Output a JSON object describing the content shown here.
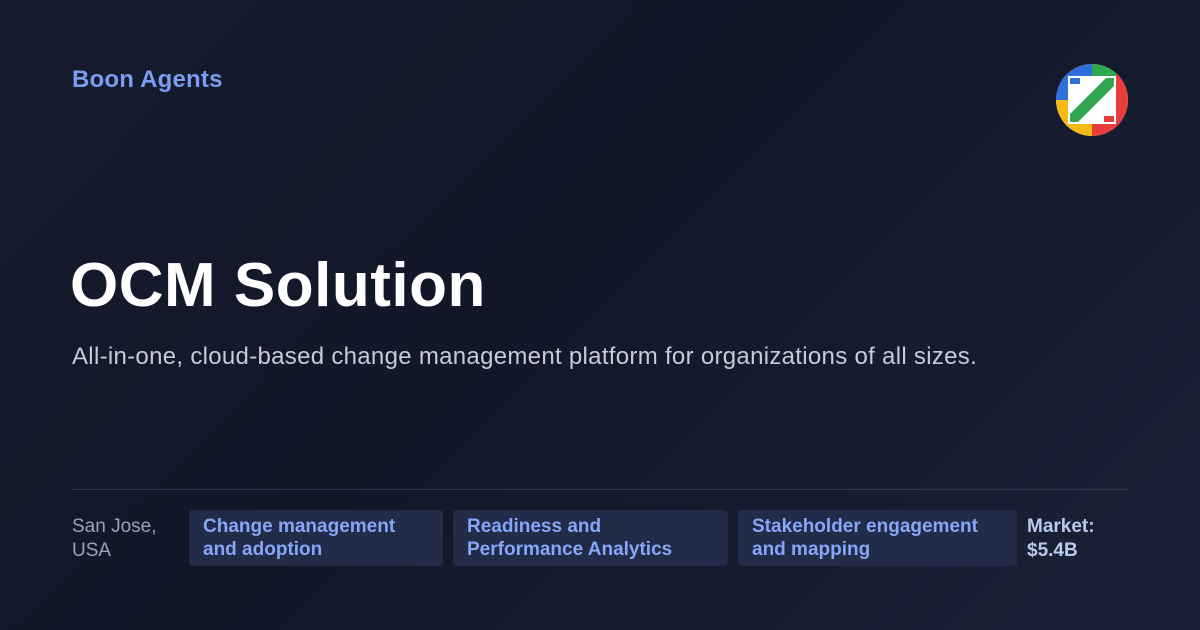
{
  "brand": {
    "name": "Boon Agents"
  },
  "logo": {
    "icon": "boon-agents-logo-icon",
    "colors": [
      "#2e6fdb",
      "#e93c3c",
      "#f5b916",
      "#2fa84f"
    ]
  },
  "hero": {
    "title": "OCM Solution",
    "subtitle": "All-in-one, cloud-based change management platform for organizations of all sizes."
  },
  "footer": {
    "location_line1": "San Jose,",
    "location_line2": "USA",
    "tags": [
      {
        "line1": "Change management",
        "line2": "and adoption"
      },
      {
        "line1": "Readiness and",
        "line2": "Performance Analytics"
      },
      {
        "line1": "Stakeholder engagement",
        "line2": "and mapping"
      }
    ],
    "market_label": "Market:",
    "market_value": "$5.4B"
  },
  "colors": {
    "background": "#141a2c",
    "brand_text": "#7b9cf2",
    "tag_background": "#222b48",
    "tag_text": "#86a6f7"
  }
}
